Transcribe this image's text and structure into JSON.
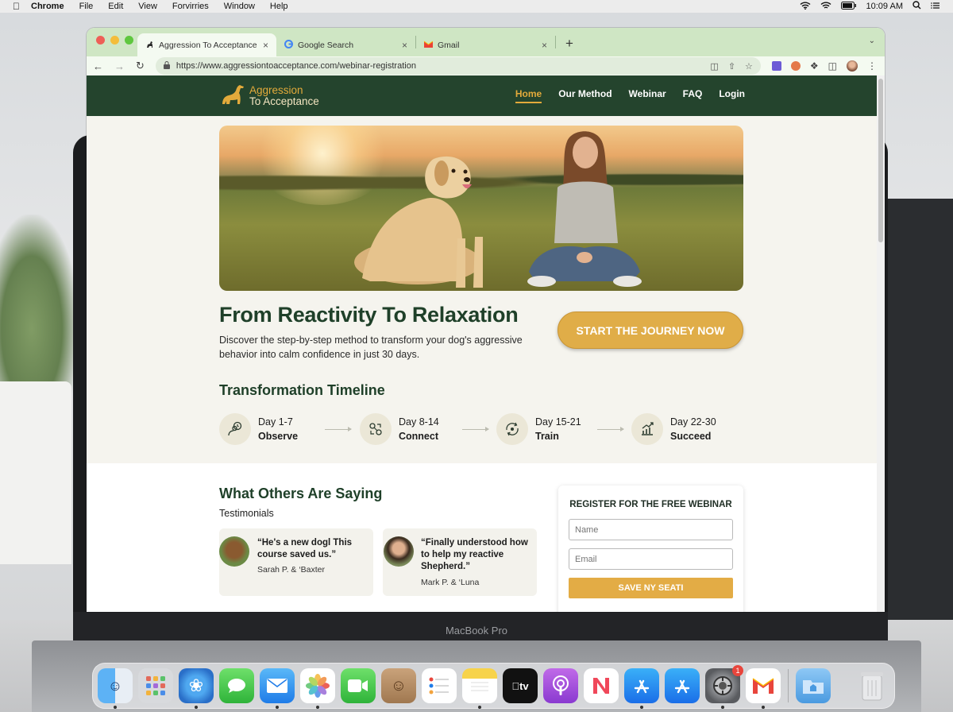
{
  "menubar": {
    "items": [
      "Chrome",
      "File",
      "Edit",
      "View",
      "Forvirries",
      "Window",
      "Help"
    ],
    "clock": "10:09 AM"
  },
  "browser": {
    "tabs": [
      {
        "title": "Aggression To Acceptance - W",
        "active": true
      },
      {
        "title": "Google Search",
        "active": false
      },
      {
        "title": "Gmail",
        "active": false
      }
    ],
    "new_tab": "+",
    "url": "https://www.aggressiontoacceptance.com/webinar-registration"
  },
  "site": {
    "logo_line1": "Aggression",
    "logo_line2": "To Acceptance",
    "nav": [
      {
        "label": "Home",
        "active": true
      },
      {
        "label": "Our Method",
        "active": false
      },
      {
        "label": "Webinar",
        "active": false
      },
      {
        "label": "FAQ",
        "active": false
      },
      {
        "label": "Login",
        "active": false
      }
    ],
    "headline": "From Reactivity To Relaxation",
    "subcopy": "Discover the step-by-step method to transform your dog's aggressive behavior into calm confidence in just 30 days.",
    "cta": "START THE JOURNEY NOW",
    "timeline_title": "Transformation Timeline",
    "timeline": [
      {
        "days": "Day 1-7",
        "name": "Observe",
        "icon": "observe-icon"
      },
      {
        "days": "Day 8-14",
        "name": "Connect",
        "icon": "connect-icon"
      },
      {
        "days": "Day 15-21",
        "name": "Train",
        "icon": "train-icon"
      },
      {
        "days": "Day 22-30",
        "name": "Succeed",
        "icon": "succeed-icon"
      }
    ],
    "testimonials_title": "What Others Are Saying",
    "testimonials_sub": "Testimonials",
    "testimonials": [
      {
        "quote": "“He's a new dogl This course saved us.”",
        "author": "Sarah P. & ‘Baxter"
      },
      {
        "quote": "“Finally understood how to help my reactive Shepherd.”",
        "author": "Mark P. & ‘Luna"
      }
    ],
    "register": {
      "title": "REGISTER FOR THE FREE WEBINAR",
      "name_placeholder": "Name",
      "email_placeholder": "Email",
      "submit": "SAVE NY SEATI"
    }
  },
  "laptop_label": "MacBook Pro",
  "dock": {
    "apps": [
      "Finder",
      "Launchpad",
      "Safari",
      "Messages",
      "Mail",
      "Photos",
      "FaceTime",
      "Contacts",
      "Reminders",
      "Notes",
      "TV",
      "Podcasts",
      "News",
      "App Store",
      "App Store",
      "System Settings",
      "Gmail"
    ],
    "settings_badge": "1"
  },
  "colors": {
    "brand_green": "#24442d",
    "brand_gold": "#e0ad48",
    "tab_bar": "#cfe6c4"
  }
}
